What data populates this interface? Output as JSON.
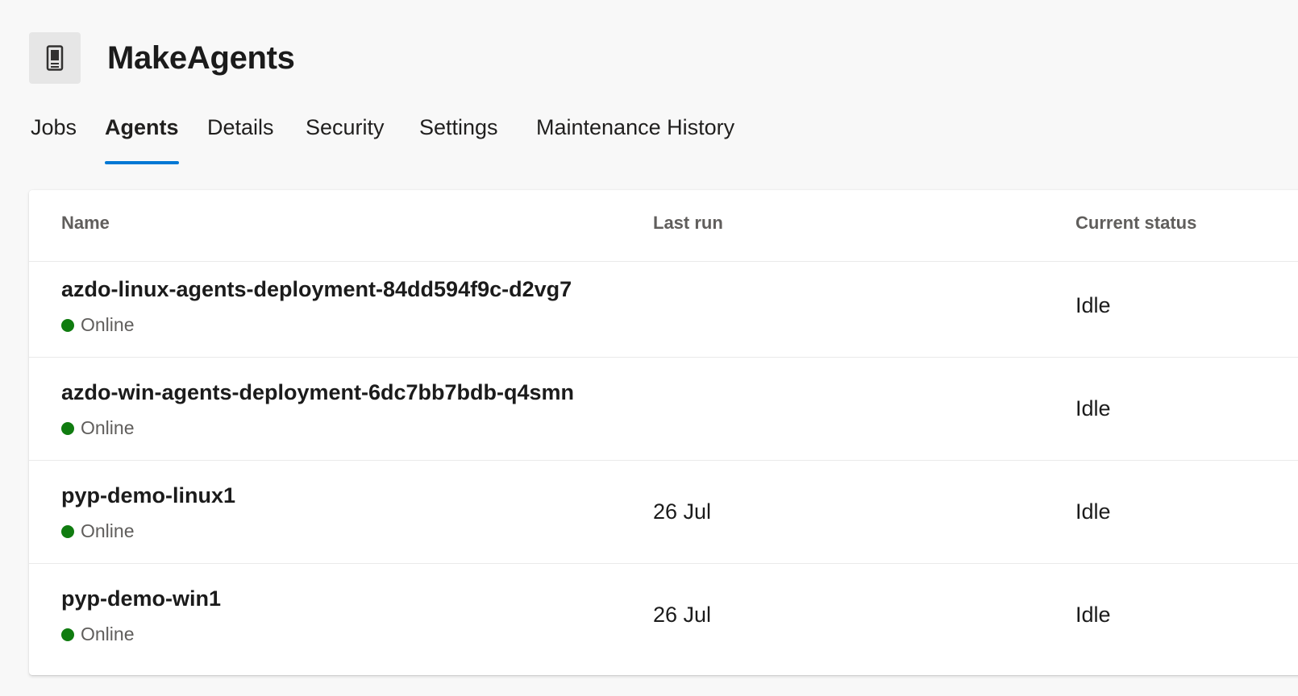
{
  "header": {
    "icon": "agent-pool-icon",
    "title": "MakeAgents"
  },
  "tabs": [
    {
      "label": "Jobs",
      "selected": false
    },
    {
      "label": "Agents",
      "selected": true
    },
    {
      "label": "Details",
      "selected": false
    },
    {
      "label": "Security",
      "selected": false
    },
    {
      "label": "Settings",
      "selected": false
    },
    {
      "label": "Maintenance History",
      "selected": false
    }
  ],
  "colors": {
    "accent": "#0078d4",
    "online": "#107c10"
  },
  "table": {
    "columns": [
      "Name",
      "Last run",
      "Current status"
    ],
    "rows": [
      {
        "name": "azdo-linux-agents-deployment-84dd594f9c-d2vg7",
        "state": "Online",
        "last_run": "",
        "status": "Idle"
      },
      {
        "name": "azdo-win-agents-deployment-6dc7bb7bdb-q4smn",
        "state": "Online",
        "last_run": "",
        "status": "Idle"
      },
      {
        "name": "pyp-demo-linux1",
        "state": "Online",
        "last_run": "26 Jul",
        "status": "Idle"
      },
      {
        "name": "pyp-demo-win1",
        "state": "Online",
        "last_run": "26 Jul",
        "status": "Idle"
      }
    ]
  }
}
